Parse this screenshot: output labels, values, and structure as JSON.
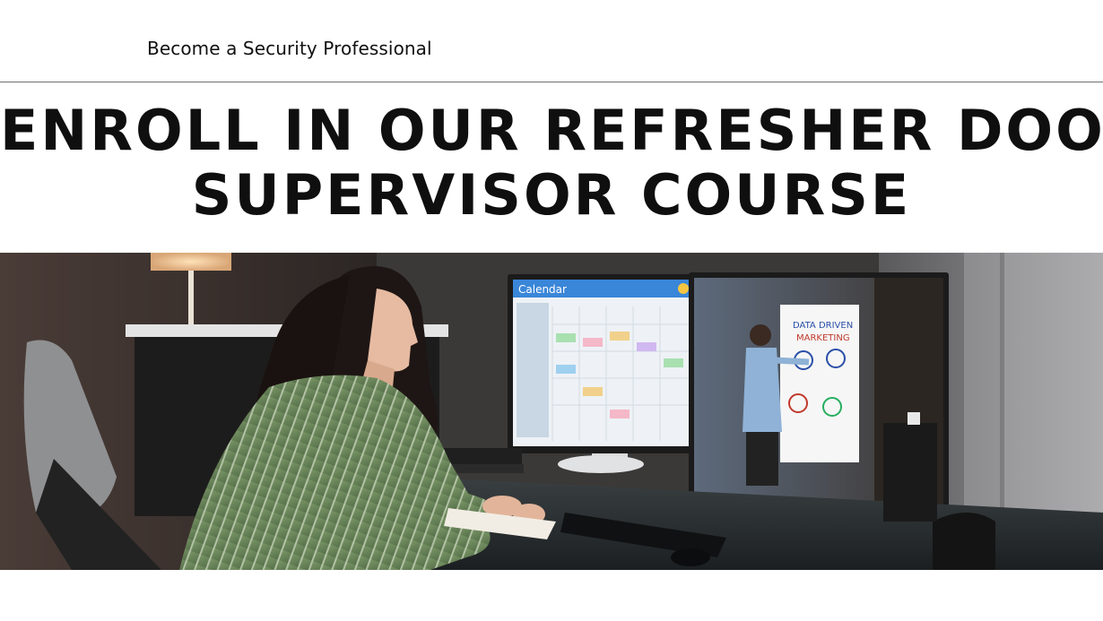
{
  "header": {
    "tagline": "Become a Security Professional"
  },
  "hero": {
    "headline_line1": "ENROLL IN OUR REFRESHER DOOR",
    "headline_line2": "SUPERVISOR COURSE"
  },
  "photo": {
    "calendar_title": "Calendar",
    "whiteboard_line1": "DATA DRIVEN",
    "whiteboard_line2": "MARKETING"
  },
  "colors": {
    "text": "#111111",
    "divider": "#6f6f6f",
    "calendar_header": "#3a86d8",
    "shirt": "#6f8a5c"
  }
}
